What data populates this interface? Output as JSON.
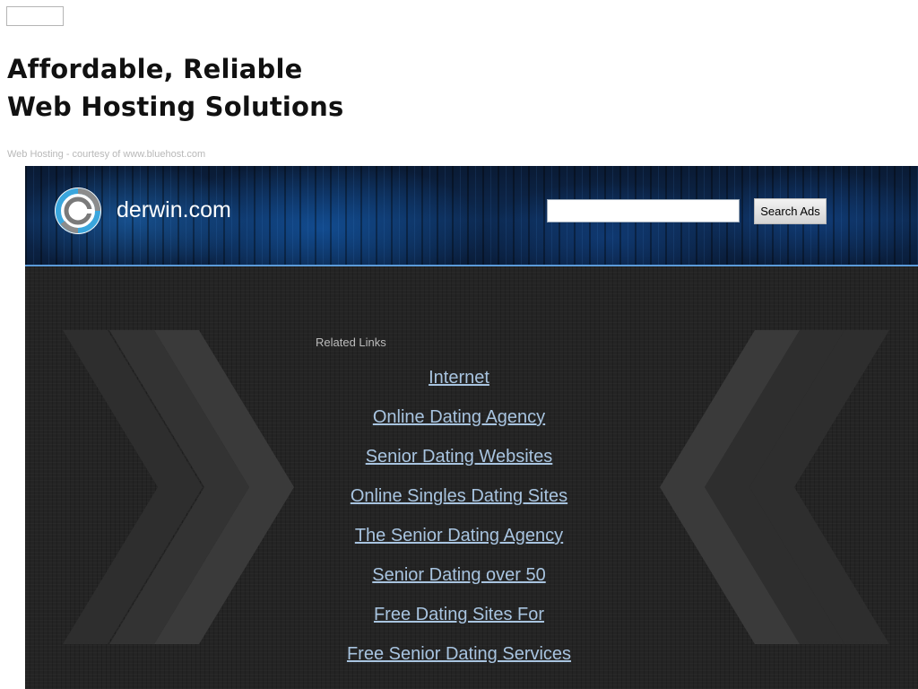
{
  "promo": {
    "headline_line1": "Affordable, Reliable",
    "headline_line2": "Web Hosting Solutions",
    "courtesy": "Web Hosting - courtesy of www.bluehost.com"
  },
  "site": {
    "domain": "derwin.com",
    "logo_icon": "swirl-logo-icon"
  },
  "search": {
    "value": "",
    "placeholder": "",
    "button_label": "Search Ads"
  },
  "related": {
    "heading": "Related Links",
    "links": [
      "Internet",
      "Online Dating Agency",
      "Senior Dating Websites",
      "Online Singles Dating Sites",
      "The Senior Dating Agency",
      "Senior Dating over 50",
      "Free Dating Sites For",
      "Free Senior Dating Services"
    ]
  },
  "colors": {
    "banner": "#0d2a52",
    "body": "#242424",
    "link": "#a8c4e0",
    "accent_line": "#5b9bd9"
  }
}
